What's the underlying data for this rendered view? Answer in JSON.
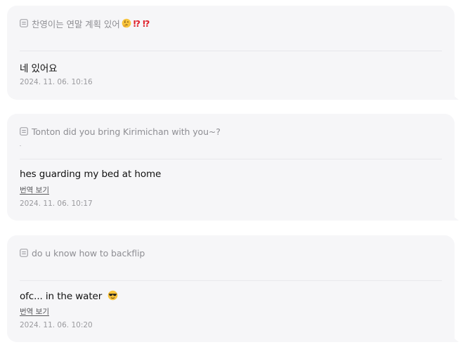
{
  "cards": [
    {
      "question": "찬영이는 연말 계획 있어",
      "question_marks": [
        "⁉",
        "⁉"
      ],
      "question_emoji": "thinking-face-icon",
      "answer": "네 있어요",
      "timestamp": "2024. 11. 06. 10:16"
    },
    {
      "question": "Tonton did you bring Kirimichan with you~?",
      "answer": "hes guarding my bed at home",
      "translate_label": "번역 보기",
      "timestamp": "2024. 11. 06. 10:17"
    },
    {
      "question": "do u know how to backflip",
      "answer": "ofc... in the water",
      "answer_emoji": "sunglasses-face-icon",
      "translate_label": "번역 보기",
      "timestamp": "2024. 11. 06. 10:20"
    }
  ],
  "colors": {
    "card_bg": "#f6f6f8",
    "question_text": "#8e8e93",
    "answer_text": "#111111",
    "timestamp_text": "#9a9a9e",
    "accent_red": "#e0202a"
  }
}
